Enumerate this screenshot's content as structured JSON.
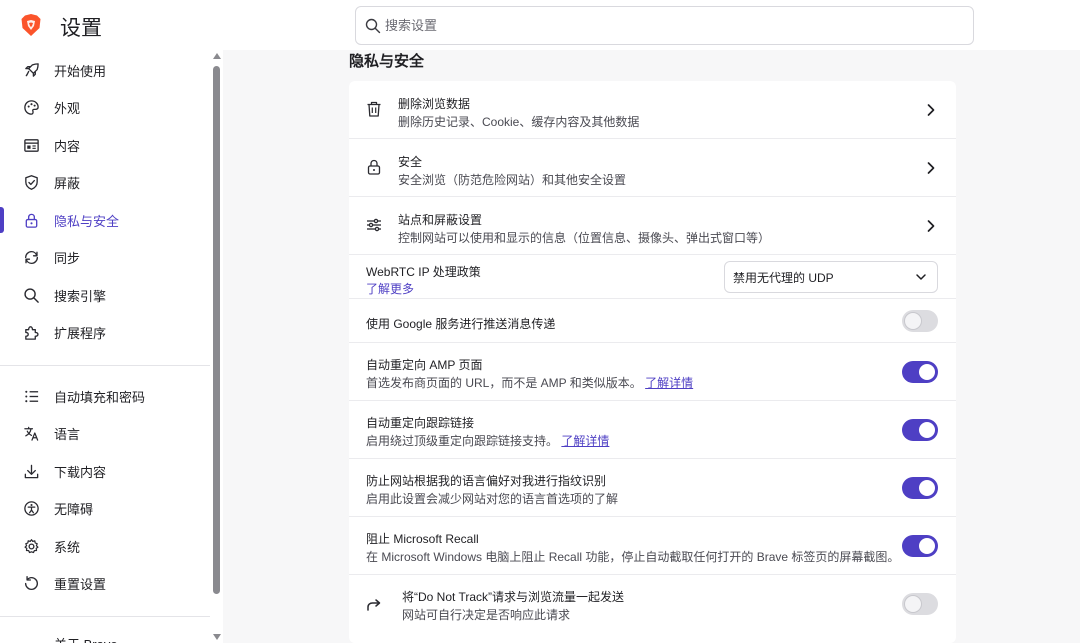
{
  "header": {
    "app_title": "设置",
    "search_placeholder": "搜索设置"
  },
  "sidebar": {
    "items": [
      {
        "label": "开始使用",
        "icon": "rocket-icon"
      },
      {
        "label": "外观",
        "icon": "palette-icon"
      },
      {
        "label": "内容",
        "icon": "content-icon"
      },
      {
        "label": "屏蔽",
        "icon": "shield-icon"
      },
      {
        "label": "隐私与安全",
        "icon": "lock-icon",
        "active": true
      },
      {
        "label": "同步",
        "icon": "sync-icon"
      },
      {
        "label": "搜索引擎",
        "icon": "search-icon"
      },
      {
        "label": "扩展程序",
        "icon": "puzzle-icon"
      },
      {
        "label": "自动填充和密码",
        "icon": "list-icon"
      },
      {
        "label": "语言",
        "icon": "translate-icon"
      },
      {
        "label": "下载内容",
        "icon": "download-icon"
      },
      {
        "label": "无障碍",
        "icon": "accessibility-icon"
      },
      {
        "label": "系统",
        "icon": "gear-icon"
      },
      {
        "label": "重置设置",
        "icon": "reset-icon"
      },
      {
        "label": "关于 Brave",
        "icon": ""
      }
    ]
  },
  "main": {
    "section_title": "隐私与安全",
    "rows": [
      {
        "title": "删除浏览数据",
        "subtitle": "删除历史记录、Cookie、缓存内容及其他数据",
        "icon": "trash-icon"
      },
      {
        "title": "安全",
        "subtitle": "安全浏览（防范危险网站）和其他安全设置",
        "icon": "lock-icon"
      },
      {
        "title": "站点和屏蔽设置",
        "subtitle": "控制网站可以使用和显示的信息（位置信息、摄像头、弹出式窗口等）",
        "icon": "sliders-icon"
      }
    ],
    "webrtc": {
      "title": "WebRTC IP 处理政策",
      "link": "了解更多",
      "selected": "禁用无代理的 UDP"
    },
    "toggles": [
      {
        "title": "使用 Google 服务进行推送消息传递",
        "subtitle": "",
        "link": "",
        "on": false
      },
      {
        "title": "自动重定向 AMP 页面",
        "subtitle": "首选发布商页面的 URL，而不是 AMP 和类似版本。",
        "link": "了解详情",
        "on": true
      },
      {
        "title": "自动重定向跟踪链接",
        "subtitle": "启用绕过顶级重定向跟踪链接支持。",
        "link": "了解详情",
        "on": true
      },
      {
        "title": "防止网站根据我的语言偏好对我进行指纹识别",
        "subtitle": "启用此设置会减少网站对您的语言首选项的了解",
        "link": "",
        "on": true
      },
      {
        "title": "阻止 Microsoft Recall",
        "subtitle": "在 Microsoft Windows 电脑上阻止 Recall 功能，停止自动截取任何打开的 Brave 标签页的屏幕截图。",
        "link": "",
        "on": true
      },
      {
        "title": "将“Do Not Track”请求与浏览流量一起发送",
        "subtitle": "网站可自行决定是否响应此请求",
        "link": "",
        "on": false,
        "icon": "share-arrow-icon"
      }
    ]
  },
  "colors": {
    "accent": "#4e3fc4",
    "brand": "#fb542b",
    "toggle_off": "#dcdce0",
    "background": "#f7f7f8"
  }
}
